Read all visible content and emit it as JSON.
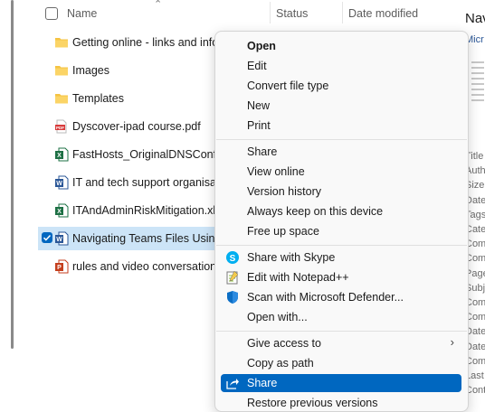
{
  "header": {
    "name": "Name",
    "status": "Status",
    "date_modified": "Date modified"
  },
  "files": [
    {
      "name": "Getting online - links and info",
      "icon": "folder-icon"
    },
    {
      "name": "Images",
      "icon": "folder-icon"
    },
    {
      "name": "Templates",
      "icon": "folder-icon"
    },
    {
      "name": "Dyscover-ipad course.pdf",
      "icon": "pdf-icon"
    },
    {
      "name": "FastHosts_OriginalDNSConfig",
      "icon": "excel-icon"
    },
    {
      "name": "IT and tech support organisation",
      "icon": "word-icon"
    },
    {
      "name": "ITAndAdminRiskMitigation.xlsx",
      "icon": "excel-icon"
    },
    {
      "name": "Navigating Teams Files Using",
      "icon": "word-icon",
      "selected": true
    },
    {
      "name": "rules and video conversations",
      "icon": "powerpoint-icon"
    }
  ],
  "preview": {
    "title": "Nav",
    "subtitle": "Micr",
    "properties": [
      "Title",
      "Auth",
      "Size",
      "Date",
      "Tags",
      "Cate",
      "Com",
      "Com",
      "Page",
      "Subj",
      "Com",
      "Com",
      "Date",
      "Date",
      "Com",
      "Last",
      "Cont"
    ]
  },
  "context_menu": {
    "group1": [
      "Open",
      "Edit",
      "Convert file type",
      "New",
      "Print"
    ],
    "group2": [
      "Share",
      "View online",
      "Version history",
      "Always keep on this device",
      "Free up space"
    ],
    "group3": [
      {
        "label": "Share with Skype",
        "icon": "skype-icon"
      },
      {
        "label": "Edit with Notepad++",
        "icon": "notepad-plus-plus-icon"
      },
      {
        "label": "Scan with Microsoft Defender...",
        "icon": "defender-shield-icon"
      },
      {
        "label": "Open with..."
      }
    ],
    "group4": [
      {
        "label": "Give access to",
        "submenu": true
      },
      {
        "label": "Copy as path"
      },
      {
        "label": "Share",
        "icon": "share-icon",
        "highlighted": true
      },
      {
        "label": "Restore previous versions"
      }
    ]
  },
  "colors": {
    "accent": "#0067c0",
    "selection": "#cce4f7",
    "folder": "#f5c342",
    "pdf": "#d83b3b",
    "excel": "#1d7044",
    "word": "#2b5797",
    "powerpoint": "#c43e1c"
  }
}
